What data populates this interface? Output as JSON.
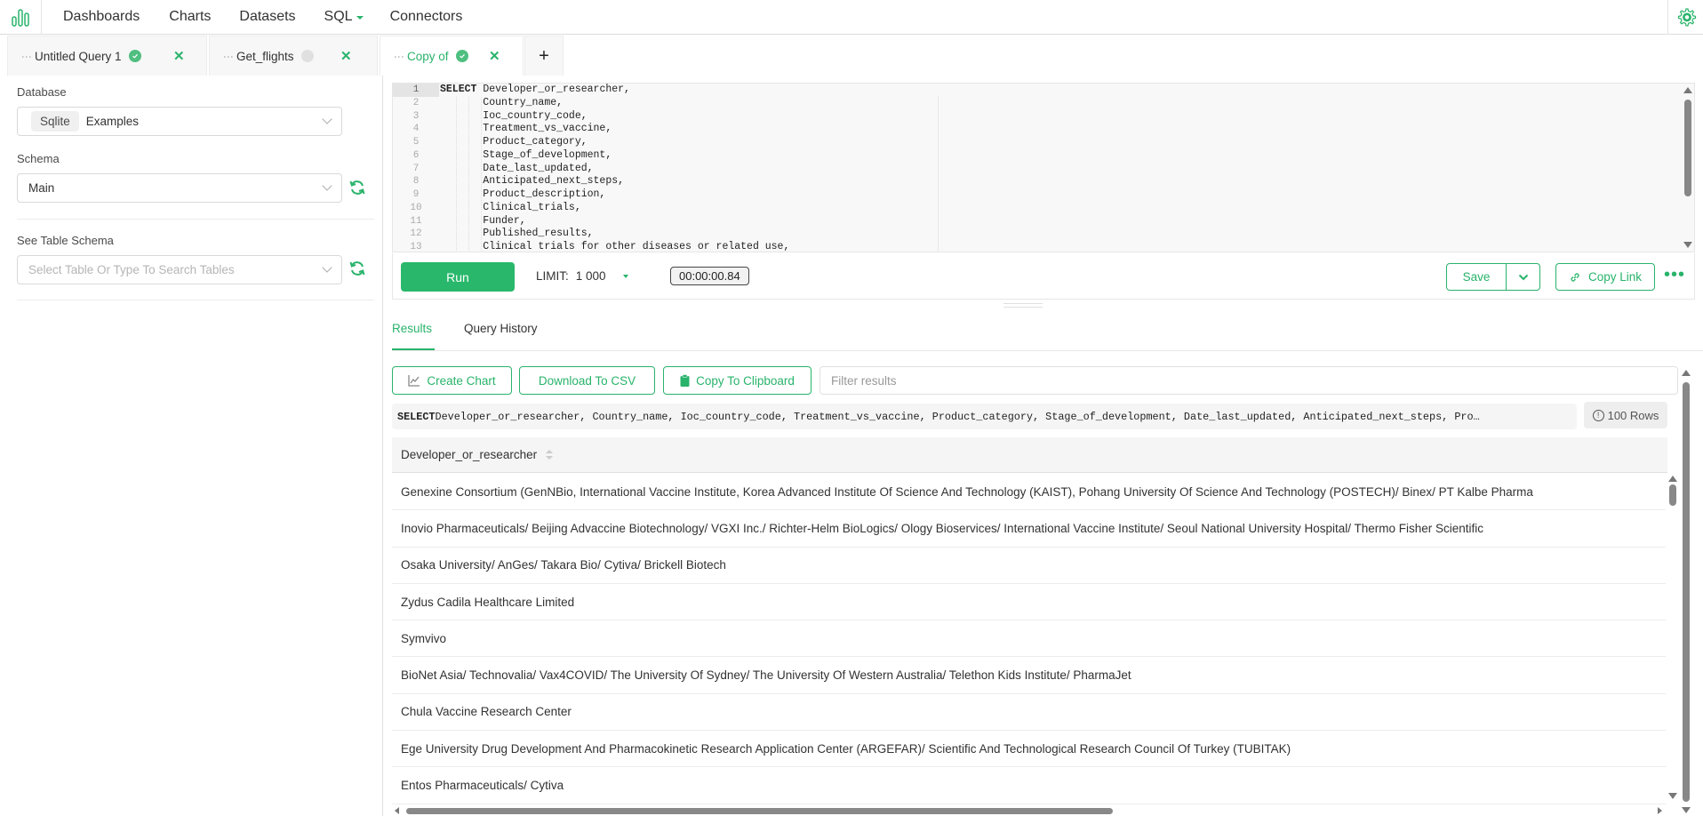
{
  "nav": {
    "logo_icon": "bar-chart-logo",
    "items": [
      "Dashboards",
      "Charts",
      "Datasets",
      "SQL",
      "Connectors"
    ],
    "settings_icon": "gear-icon"
  },
  "tabs": [
    {
      "label": "Untitled Query 1",
      "status": "success"
    },
    {
      "label": "Get_flights",
      "status": "idle"
    },
    {
      "label": "Copy of",
      "status": "success",
      "active": true
    }
  ],
  "tab_add_label": "+",
  "left": {
    "database_label": "Database",
    "database_chip": "Sqlite",
    "database_value": "Examples",
    "schema_label": "Schema",
    "schema_value": "Main",
    "table_schema_label": "See Table Schema",
    "table_placeholder": "Select Table Or Type To Search Tables"
  },
  "editor": {
    "lines": [
      {
        "n": "1",
        "kw": "SELECT",
        "text": " Developer_or_researcher,"
      },
      {
        "n": "2",
        "kw": "",
        "text": "       Country_name,"
      },
      {
        "n": "3",
        "kw": "",
        "text": "       Ioc_country_code,"
      },
      {
        "n": "4",
        "kw": "",
        "text": "       Treatment_vs_vaccine,"
      },
      {
        "n": "5",
        "kw": "",
        "text": "       Product_category,"
      },
      {
        "n": "6",
        "kw": "",
        "text": "       Stage_of_development,"
      },
      {
        "n": "7",
        "kw": "",
        "text": "       Date_last_updated,"
      },
      {
        "n": "8",
        "kw": "",
        "text": "       Anticipated_next_steps,"
      },
      {
        "n": "9",
        "kw": "",
        "text": "       Product_description,"
      },
      {
        "n": "10",
        "kw": "",
        "text": "       Clinical_trials,"
      },
      {
        "n": "11",
        "kw": "",
        "text": "       Funder,"
      },
      {
        "n": "12",
        "kw": "",
        "text": "       Published_results,"
      },
      {
        "n": "13",
        "kw": "",
        "text": "       Clinical trials for other diseases or related use,"
      }
    ]
  },
  "runbar": {
    "run_label": "Run",
    "limit_label": "LIMIT:",
    "limit_value": "1 000",
    "timer": "00:00:00.84",
    "save_label": "Save",
    "copy_link_label": "Copy Link",
    "more_label": "•••"
  },
  "results": {
    "tabs": [
      "Results",
      "Query History"
    ],
    "create_chart": "Create Chart",
    "download_csv": "Download To CSV",
    "copy_clipboard": "Copy To Clipboard",
    "filter_placeholder": "Filter results",
    "sql_keyword": "SELECT",
    "sql_rest": " Developer_or_researcher, Country_name, Ioc_country_code, Treatment_vs_vaccine, Product_category, Stage_of_development, Date_last_updated, Anticipated_next_steps, Pro…",
    "rows_badge": "100 Rows",
    "column_header": "Developer_or_researcher",
    "rows": [
      "Genexine Consortium (GenNBio, International Vaccine Institute, Korea Advanced Institute Of Science And Technology (KAIST), Pohang University Of Science And Technology (POSTECH)/ Binex/ PT Kalbe Pharma",
      "Inovio Pharmaceuticals/ Beijing Advaccine Biotechnology/ VGXI Inc./ Richter-Helm BioLogics/ Ology Bioservices/ International Vaccine Institute/ Seoul National University Hospital/ Thermo Fisher Scientific",
      "Osaka University/ AnGes/ Takara Bio/ Cytiva/ Brickell Biotech",
      "Zydus Cadila Healthcare Limited",
      "Symvivo",
      "BioNet Asia/ Technovalia/ Vax4COVID/ The University Of Sydney/ The University Of Western Australia/ Telethon Kids Institute/ PharmaJet",
      "Chula Vaccine Research Center",
      "Ege University Drug Development And Pharmacokinetic Research Application Center (ARGEFAR)/ Scientific And Technological Research Council Of Turkey (TUBITAK)",
      "Entos Pharmaceuticals/ Cytiva"
    ]
  },
  "colors": {
    "accent": "#29b36b",
    "text": "#323232",
    "border": "#e0e0e0"
  }
}
